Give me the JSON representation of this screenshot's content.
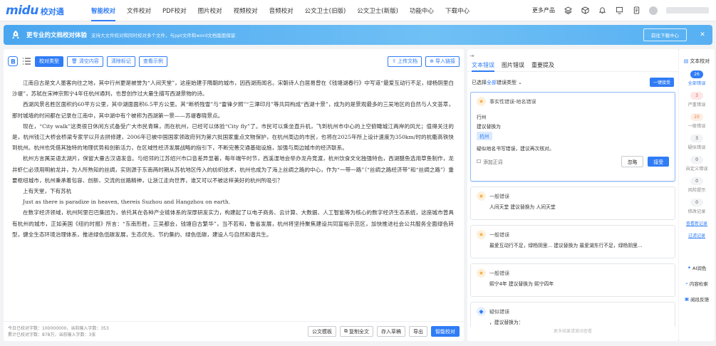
{
  "app": {
    "brand": "midu",
    "brand_cn": "校对通"
  },
  "nav": [
    "智能校对",
    "文件校对",
    "PDF校对",
    "图片校对",
    "视频校对",
    "音频校对",
    "公文卫士(旧版)",
    "公文卫士(新版)",
    "功能中心",
    "下载中心"
  ],
  "top_right": {
    "more": "更多产品"
  },
  "banner": {
    "title": "更专业的文档校对体验",
    "subtitle": "支持大文件校对和同时校对多个文件，与ppt文件和word文档版面保留",
    "button": "前往下载中心"
  },
  "toolbar": {
    "type_btn": "校对类型",
    "clear_btn": "清空内容",
    "clear_marks_btn": "清除标记",
    "example_btn": "查看示例",
    "upload_btn": "上传文档",
    "import_btn": "导入链接"
  },
  "doc": {
    "p1": "江南自古是文人墨客向往之地，其中行州更是被誉为“人间天堂”，这座始建于隋朝的城市，因西湖而闻名。宋朝诗人白居易曾在《钱塘湖春行》中写道“最爱互动行不足，绿杨阴里白沙堤”，苏轼在宋神宗熙宁4年任杭州通判，也曾创作过大量生描写西湖景物的诗。",
    "p2": "西湖风景名胜区面积约60平方公里，其中湖面面积6.5平方公里。其“断桥残雪”与“雷锋夕照”“三潭印月”等共同构成“西湖十景”，成为的是景观最多的三吴地区的自然与人文荟萃，那时城墙的时间都在记录在江南中，其中湖中有个被称为西湖第一景——苏堤春晓景点。",
    "p3": "现在，“City walk”这类很日休闲方式备受广大市民青睐，而在杭州，已经可以体验“City fly”了。市民可以乘坐直升机，飞到杭州市中心的上空俯瞰城江两岸的风光；值得关注的是，杭州钱江大桥会桥梁专家学以开去拼修建，2006年已被中国国家领政府列为第六批国家重点文物保护，在杭州周边的市民，也将在2025年所上设计速度为350km/时的杭衢高铁快到杭州。杭州也凭借其独特的地理优势和创新活力，在区域性经济发展战略的指引下，不断完善交通基础设施，加强与周边城市的经济联系。",
    "p4": "杭州方言属吴语太湖片，保留大量古汉语发音。与绍邻的江苏绍兴市口音差异显著，每年端午时节，西溪湿地会举办龙舟竞渡，杭州饮食文化独强特色，西湖醋鱼选用草鱼制作，龙井虾仁必须用明前龙井，为人所熟知的丝绸，实则源于东南两时期从苏杭地区传入的纺织技术，杭州也成为了海上丝绸之路的中心，作为“一带一路”（“丝绸之路经济带”和“丝绸之路”）重要枢纽城市，杭州秉承着包容、创新、交流的丝路精神，让浙江走向世界，谁又可以不被这样美好的杭州所吸引？",
    "p5": "上有天堂，下有苏杭",
    "p6": "Just as there is paradize in heaven, thereis Suzhou and Hangzhou on earth.",
    "p7": "在数字经济领域，杭州阿里巴巴集团为，依托其在各种产业链体系的深厚研发实力，构建起了以电子商务、云计算、大数据、人工智能等为核心的数字经济生态系统，这座城市曾具有杭州的城市，正如美国《纽约时报》所言：“东南形胜，三吴都会，钱塘自古繁华”，当不若和，鲁省发展，杭州将坚持聚焦建设共同富裕示范区，加快推进社会公共服务全面绿色转型，健全生态环境治理体系，推进绿色低碳发展，生态优先、节约集约、绿色低碳，建设人与自然和谐共生。"
  },
  "footer": {
    "stat1": "今日已校对字数：100000000，当前输入字数：353",
    "stat2": "累计已校对字数：878万，当前输入字数：3张",
    "btn_official": "公文模板",
    "btn_copy": "复制全文",
    "btn_save": "存入草稿",
    "btn_export": "导出",
    "btn_check": "智能校对"
  },
  "panel": {
    "tabs": [
      "文本错误",
      "图片错误",
      "重要提及"
    ],
    "filter_prefix": "已选择",
    "filter_all": "全部",
    "filter_suffix": "错误类型",
    "filter_btn": "一键接受",
    "cards": [
      {
        "title": "事实性错误-地名错误",
        "orig": "行州",
        "hint": "建议替换为",
        "suggest": "杭州",
        "desc": "疑似地名书写错误，建议再次核对。",
        "add": "添加正词",
        "ignore": "忽略",
        "accept": "接受"
      },
      {
        "title": "一般错误",
        "line": "人间天堂   建议替换为  人间天堂"
      },
      {
        "title": "一般错误",
        "line": "最爱互动行不足，绿杨阴里...    建议替换为  最爱湖东行不足，绿杨阴里..."
      },
      {
        "title": "一般错误",
        "line": "熙宁4年   建议替换为  熙宁四年"
      },
      {
        "title": "疑似错误",
        "line": "，建议替换为："
      }
    ],
    "end": "更多结果请滚动查看"
  },
  "side": {
    "title": "文本校对",
    "items": [
      {
        "num": "26",
        "label": "全部错误"
      },
      {
        "num": "3",
        "label": "严重错误"
      },
      {
        "num": "20",
        "label": "一般错误"
      },
      {
        "num": "3",
        "label": "疑似错误"
      },
      {
        "num": "0",
        "label": "自定义错误"
      },
      {
        "num": "0",
        "label": "风险提示"
      },
      {
        "num": "0",
        "label": "修改记录"
      }
    ],
    "links": [
      "查看新记录",
      "过滤记录"
    ],
    "tools": [
      "AI润色",
      "内容检索",
      "阅段反馈"
    ]
  }
}
